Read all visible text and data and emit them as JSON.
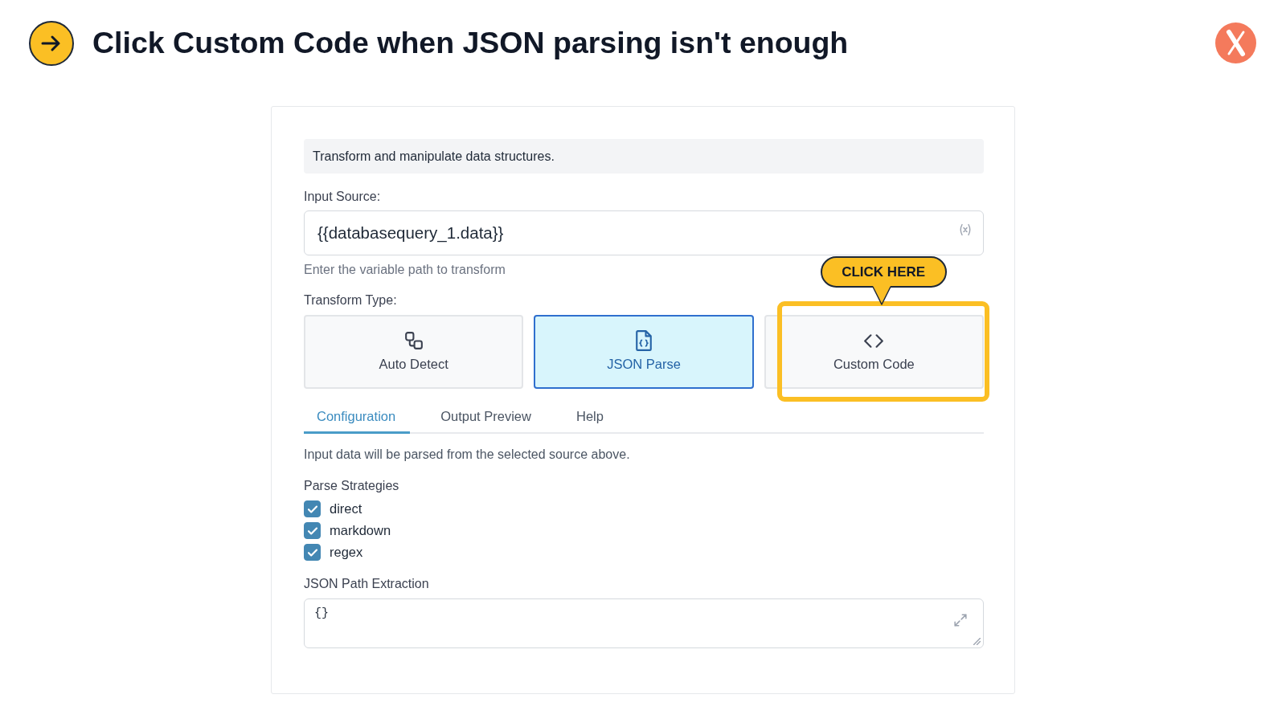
{
  "header": {
    "title": "Click Custom Code when JSON parsing isn't enough"
  },
  "panel": {
    "description": "Transform and manipulate data structures.",
    "input_source": {
      "label": "Input Source:",
      "value": "{{databasequery_1.data}}",
      "hint": "Enter the variable path to transform"
    },
    "transform_type": {
      "label": "Transform Type:",
      "options": [
        {
          "kind": "auto",
          "label": "Auto Detect",
          "selected": false,
          "highlighted": false
        },
        {
          "kind": "json",
          "label": "JSON Parse",
          "selected": true,
          "highlighted": false
        },
        {
          "kind": "code",
          "label": "Custom Code",
          "selected": false,
          "highlighted": true
        }
      ]
    },
    "tabs": [
      {
        "label": "Configuration",
        "selected": true
      },
      {
        "label": "Output Preview",
        "selected": false
      },
      {
        "label": "Help",
        "selected": false
      }
    ],
    "configuration": {
      "note": "Input data will be parsed from the selected source above.",
      "strategies": {
        "label": "Parse Strategies",
        "items": [
          {
            "label": "direct",
            "checked": true
          },
          {
            "label": "markdown",
            "checked": true
          },
          {
            "label": "regex",
            "checked": true
          }
        ]
      },
      "path_extraction": {
        "label": "JSON Path Extraction",
        "value": "{}"
      }
    }
  },
  "callout": {
    "text": "CLICK HERE"
  }
}
